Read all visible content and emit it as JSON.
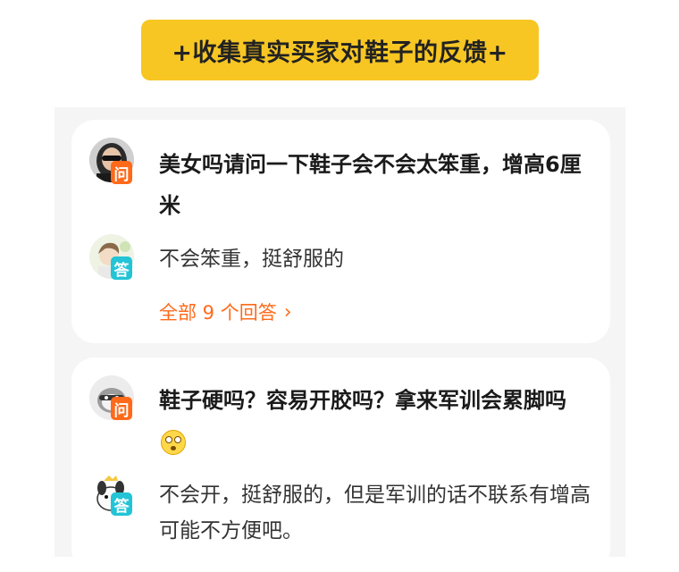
{
  "header": {
    "title": "+收集真实买家对鞋子的反馈+",
    "accent_color": "#f7c623"
  },
  "qa_items": [
    {
      "question": "美女吗请问一下鞋子会不会太笨重，增高6厘米",
      "question_badge": "问",
      "answer": "不会笨重，挺舒服的",
      "answer_badge": "答",
      "more_label": "全部 9 个回答"
    },
    {
      "question": "鞋子硬吗？容易开胶吗？拿来军训会累脚吗",
      "question_badge": "问",
      "question_emoji": "flushed-face-icon",
      "answer": "不会开，挺舒服的，但是军训的话不联系有增高可能不方便吧。",
      "answer_badge": "答"
    }
  ],
  "colors": {
    "question_badge": "#ff6a1a",
    "answer_badge": "#22c4d6",
    "link": "#ff6a1a"
  }
}
